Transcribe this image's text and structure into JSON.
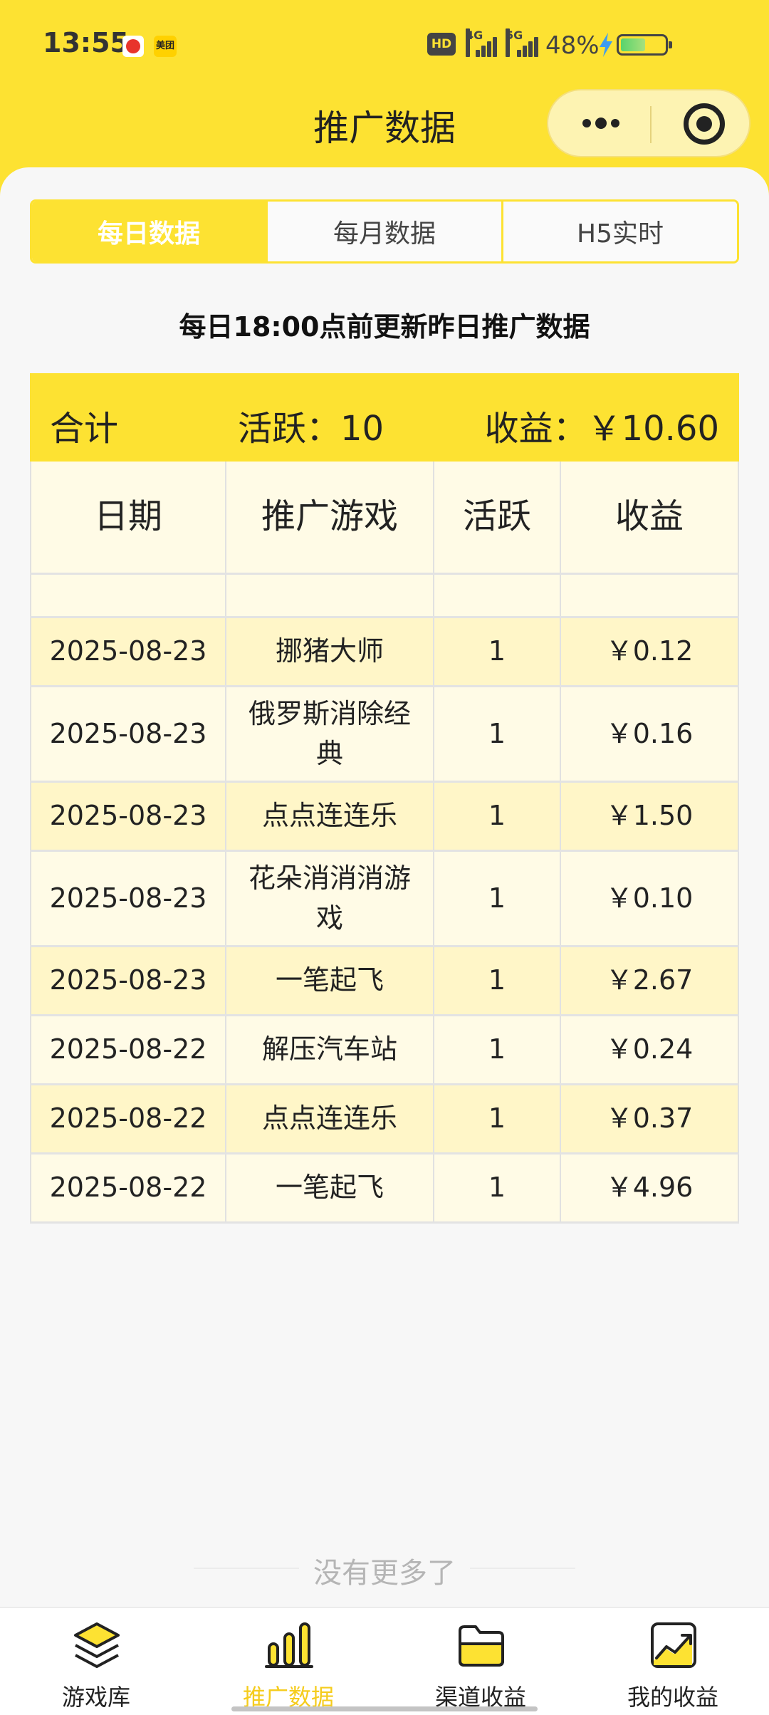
{
  "status": {
    "time": "13:55",
    "app2_text": "美团",
    "hd": "HD",
    "net1": "4G",
    "net2": "5G",
    "battery": "48%"
  },
  "nav": {
    "title": "推广数据"
  },
  "tabs": [
    {
      "label": "每日数据",
      "active": true
    },
    {
      "label": "每月数据",
      "active": false
    },
    {
      "label": "H5实时",
      "active": false
    }
  ],
  "notice": "每日18:00点前更新昨日推广数据",
  "summary": {
    "label": "合计",
    "active": "活跃：10",
    "income": "收益：￥10.60"
  },
  "table": {
    "headers": [
      "日期",
      "推广游戏",
      "活跃",
      "收益"
    ],
    "rows": [
      {
        "date": "2025-08-23",
        "game": "挪猪大师",
        "active": "1",
        "income": "￥0.12",
        "h": 94
      },
      {
        "date": "2025-08-23",
        "game": "俄罗斯消除经典",
        "active": "1",
        "income": "￥0.16",
        "h": 131
      },
      {
        "date": "2025-08-23",
        "game": "点点连连乐",
        "active": "1",
        "income": "￥1.50",
        "h": 94
      },
      {
        "date": "2025-08-23",
        "game": "花朵消消消游戏",
        "active": "1",
        "income": "￥0.10",
        "h": 131
      },
      {
        "date": "2025-08-23",
        "game": "一笔起飞",
        "active": "1",
        "income": "￥2.67",
        "h": 94
      },
      {
        "date": "2025-08-22",
        "game": "解压汽车站",
        "active": "1",
        "income": "￥0.24",
        "h": 94
      },
      {
        "date": "2025-08-22",
        "game": "点点连连乐",
        "active": "1",
        "income": "￥0.37",
        "h": 94
      },
      {
        "date": "2025-08-22",
        "game": "一笔起飞",
        "active": "1",
        "income": "￥4.96",
        "h": 94
      }
    ]
  },
  "footer_text": "没有更多了",
  "tabbar": [
    {
      "label": "游戏库",
      "icon": "layers-icon",
      "active": false
    },
    {
      "label": "推广数据",
      "icon": "bar-chart-icon",
      "active": true
    },
    {
      "label": "渠道收益",
      "icon": "folder-icon",
      "active": false
    },
    {
      "label": "我的收益",
      "icon": "trend-chart-icon",
      "active": false
    }
  ],
  "colors": {
    "accent": "#fde232",
    "accent_text": "#f5cc1e"
  }
}
